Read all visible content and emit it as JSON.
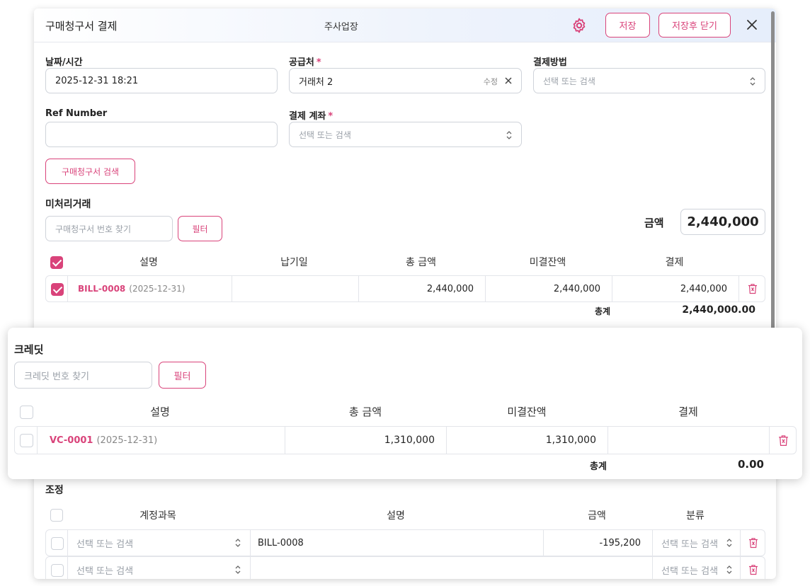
{
  "header": {
    "title": "구매청구서 결제",
    "company": "주사업장",
    "save_label": "저장",
    "save_close_label": "저장후 닫기",
    "icons": {
      "settings": "gear-icon",
      "close": "close-icon"
    }
  },
  "colors": {
    "accent": "#d9437a",
    "border": "#cfd3da"
  },
  "form": {
    "date_label": "날짜/시간",
    "date_value": "2025-12-31 18:21",
    "vendor_label": "공급처",
    "vendor_value": "거래처 2",
    "vendor_edit": "수정",
    "payment_method_label": "결제방법",
    "payment_method_placeholder": "선택 또는 검색",
    "ref_label": "Ref Number",
    "ref_value": "",
    "account_label": "결제 계좌",
    "account_placeholder": "선택 또는 검색",
    "required_mark": "*",
    "bill_search_label": "구매청구서 검색"
  },
  "pending": {
    "title": "미처리거래",
    "search_placeholder": "구매청구서 번호 찾기",
    "filter_label": "필터",
    "amount_label": "금액",
    "amount_value": "2,440,000",
    "columns": [
      "설명",
      "납기일",
      "총 금액",
      "미결잔액",
      "결제"
    ],
    "rows": [
      {
        "id": "BILL-0008",
        "date": "(2025-12-31)",
        "due": "",
        "total": "2,440,000",
        "balance": "2,440,000",
        "payment": "2,440,000",
        "checked": true
      }
    ],
    "total_label": "총계",
    "total_value": "2,440,000.00"
  },
  "credit": {
    "title": "크레딧",
    "search_placeholder": "크레딧 번호 찾기",
    "filter_label": "필터",
    "columns": [
      "설명",
      "총 금액",
      "미결잔액",
      "결제"
    ],
    "rows": [
      {
        "id": "VC-0001",
        "date": "(2025-12-31)",
        "total": "1,310,000",
        "balance": "1,310,000",
        "payment": "",
        "checked": false
      }
    ],
    "total_label": "총계",
    "total_value": "0.00"
  },
  "adjust": {
    "title": "조정",
    "columns": [
      "계정과목",
      "설명",
      "금액",
      "분류"
    ],
    "rows": [
      {
        "account": "선택 또는 검색",
        "desc": "BILL-0008",
        "amount": "-195,200",
        "category": "선택 또는 검색"
      },
      {
        "account": "선택 또는 검색",
        "desc": "",
        "amount": "",
        "category": "선택 또는 검색"
      }
    ]
  }
}
